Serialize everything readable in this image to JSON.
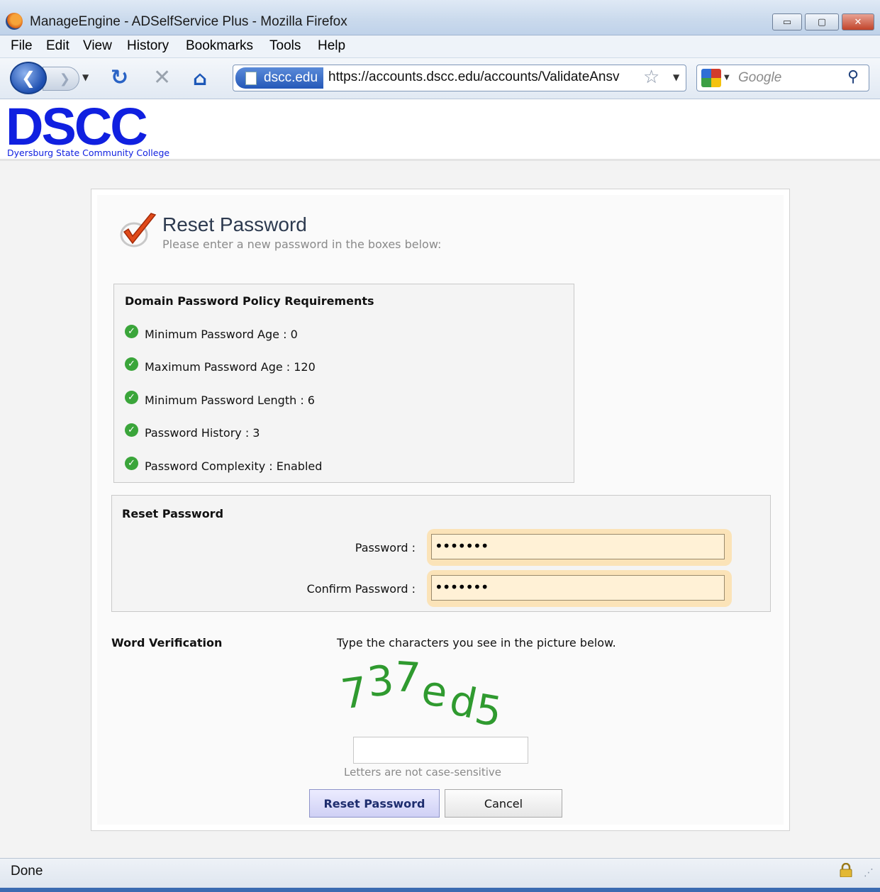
{
  "window": {
    "title": "ManageEngine - ADSelfService Plus - Mozilla Firefox",
    "controls": {
      "minimize": "▭",
      "maximize": "▢",
      "close": "✕"
    }
  },
  "menu": {
    "items": [
      {
        "label": "File"
      },
      {
        "label": "Edit"
      },
      {
        "label": "View"
      },
      {
        "label": "History"
      },
      {
        "label": "Bookmarks"
      },
      {
        "label": "Tools"
      },
      {
        "label": "Help"
      }
    ]
  },
  "navigation": {
    "site_badge": "dscc.edu",
    "url": "https://accounts.dscc.edu/accounts/ValidateAnsv",
    "search_placeholder": "Google",
    "icons": [
      "back-icon",
      "forward-icon",
      "reload-icon",
      "stop-icon",
      "home-icon",
      "bookmark-star-icon",
      "search-icon"
    ]
  },
  "header": {
    "logo_text": "DSCC",
    "logo_subtitle": "Dyersburg State Community College"
  },
  "page": {
    "title": "Reset Password",
    "subtitle": "Please enter a new password in the boxes below:"
  },
  "policy": {
    "heading": "Domain Password Policy Requirements",
    "items": [
      {
        "text": "Minimum Password Age : 0"
      },
      {
        "text": "Maximum Password Age : 120"
      },
      {
        "text": "Minimum Password Length : 6"
      },
      {
        "text": "Password History : 3"
      },
      {
        "text": "Password Complexity : Enabled"
      }
    ],
    "status_color": "#3aa53a"
  },
  "reset_form": {
    "heading": "Reset Password",
    "password_label": "Password :",
    "password_value": "•••••••",
    "confirm_label": "Confirm Password :",
    "confirm_value": "•••••••"
  },
  "verification": {
    "label": "Word Verification",
    "instruction": "Type the characters you see in the picture below.",
    "captcha_text": "737ed5",
    "captcha_color": "#2f9a2f",
    "input_value": "",
    "hint": "Letters are not case-sensitive"
  },
  "buttons": {
    "reset": "Reset Password",
    "cancel": "Cancel"
  },
  "status": {
    "text": "Done"
  }
}
